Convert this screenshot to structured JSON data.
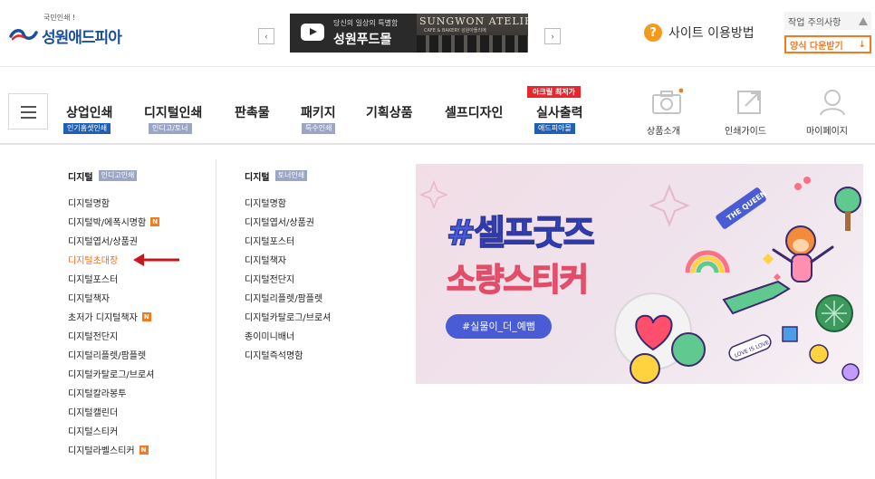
{
  "header": {
    "logo_tagline": "국민인쇄 !",
    "logo_name": "성원애드피아",
    "banner": {
      "sub": "당신의 일상의 특별함",
      "title": "성원푸드몰",
      "brand": "SUNGWON ATELIER",
      "cafe": "CAFE & BAKERY 성원아뜰리에"
    },
    "prev_icon": "‹",
    "next_icon": "›",
    "guide_icon": "?",
    "guide_label": "사이트 이용방법",
    "notice_label": "작업 주의사항",
    "download_label": "양식 다운받기",
    "download_icon": "↓"
  },
  "nav": {
    "items": [
      {
        "label": "상업인쇄",
        "sub": "인기홈셋인쇄",
        "sub_color": "#1f5fb4"
      },
      {
        "label": "디지털인쇄",
        "sub": "인디고/토너",
        "sub_color": "#9aa6c4"
      },
      {
        "label": "판촉물"
      },
      {
        "label": "패키지",
        "sub": "특수인쇄",
        "sub_color": "#9aa6c4"
      },
      {
        "label": "기획상품"
      },
      {
        "label": "셀프디자인"
      },
      {
        "label": "실사출력",
        "sub": "애드피아몰",
        "sub_color": "#1f5fb4",
        "hot": "아크릴 최저가"
      }
    ],
    "icons": [
      {
        "label": "상품소개",
        "icon": "camera-icon"
      },
      {
        "label": "인쇄가이드",
        "icon": "external-link-icon"
      },
      {
        "label": "마이페이지",
        "icon": "user-icon"
      }
    ]
  },
  "dropdown": {
    "col1": {
      "heading": "디지털",
      "tag": "인디고인쇄",
      "items": [
        {
          "label": "디지털명함"
        },
        {
          "label": "디지털박/에폭시명함",
          "badge": "N"
        },
        {
          "label": "디지털엽서/상품권"
        },
        {
          "label": "디지털초대장",
          "active": true
        },
        {
          "label": "디지털포스터"
        },
        {
          "label": "디지털책자"
        },
        {
          "label": "초저가 디지털책자",
          "badge": "N"
        },
        {
          "label": "디지털전단지"
        },
        {
          "label": "디지털리플렛/팜플렛"
        },
        {
          "label": "디지털카탈로그/브로셔"
        },
        {
          "label": "디지털칼라봉투"
        },
        {
          "label": "디지털캘린더"
        },
        {
          "label": "디지털스티커"
        },
        {
          "label": "디지털라벨스티커",
          "badge": "N"
        }
      ]
    },
    "col2": {
      "heading": "디지털",
      "tag": "토너인쇄",
      "items": [
        {
          "label": "디지털명함"
        },
        {
          "label": "디지털엽서/상품권"
        },
        {
          "label": "디지털포스터"
        },
        {
          "label": "디지털책자"
        },
        {
          "label": "디지털전단지"
        },
        {
          "label": "디지털리플렛/팜플렛"
        },
        {
          "label": "디지털카탈로그/브로셔"
        },
        {
          "label": "종이미니배너"
        },
        {
          "label": "디지털즉석명함"
        }
      ]
    }
  },
  "promo": {
    "title": "#셀프굿즈",
    "subtitle": "소량스티커",
    "pill": "#실물이_더_예뻠",
    "sticker_text_1": "THE QUEEN",
    "sticker_text_2": "LOVE IS LOVE"
  },
  "colors": {
    "brand_blue": "#1a4f9c",
    "accent_orange": "#f47a20",
    "hot_red": "#e8262b"
  }
}
